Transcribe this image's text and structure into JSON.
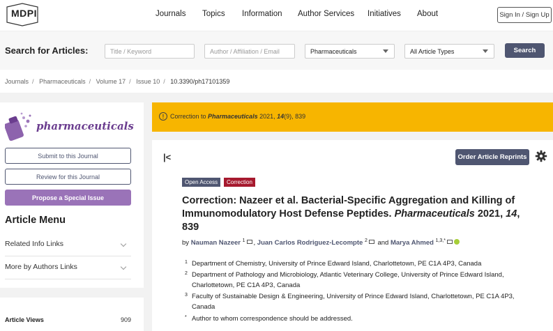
{
  "header": {
    "logo_text": "MDPI",
    "nav": [
      "Journals",
      "Topics",
      "Information",
      "Author Services",
      "Initiatives",
      "About"
    ],
    "sign_in": "Sign In / Sign Up"
  },
  "search": {
    "label": "Search for Articles:",
    "title_placeholder": "Title / Keyword",
    "author_placeholder": "Author / Affiliation / Email",
    "journal_value": "Pharmaceuticals",
    "type_value": "All Article Types",
    "button": "Search"
  },
  "breadcrumb": [
    "Journals",
    "Pharmaceuticals",
    "Volume 17",
    "Issue 10",
    "10.3390/ph17101359"
  ],
  "sidebar": {
    "journal_name": "pharmaceuticals",
    "submit": "Submit to this Journal",
    "review": "Review for this Journal",
    "propose": "Propose a Special Issue",
    "menu_title": "Article Menu",
    "related": "Related Info Links",
    "more_authors": "More by Authors Links",
    "views_label": "Article Views",
    "views_count": "909"
  },
  "alert": {
    "prefix": "Correction to ",
    "journal": "Pharmaceuticals",
    "year": " 2021, ",
    "volume": "14",
    "rest": "(9), 839"
  },
  "article": {
    "reprints": "Order Article Reprints",
    "badge_open": "Open Access",
    "badge_correction": "Correction",
    "title_main": "Correction: Nazeer et al. Bacterial-Specific Aggregation and Killing of Immunomodulatory Host Defense Peptides. ",
    "title_journal": "Pharmaceuticals",
    "title_year": " 2021, ",
    "title_vol": "14",
    "title_page": ", 839",
    "by": "by ",
    "author1": "Nauman Nazeer",
    "author1_sup": "1",
    "author2": "Juan Carlos Rodriguez-Lecompte",
    "author2_sup": "2",
    "and": " and ",
    "author3": "Marya Ahmed",
    "author3_sup": "1,3,*",
    "affiliations": [
      {
        "num": "1",
        "text": "Department of Chemistry, University of Prince Edward Island, Charlottetown, PE C1A 4P3, Canada"
      },
      {
        "num": "2",
        "text": "Department of Pathology and Microbiology, Atlantic Veterinary College, University of Prince Edward Island, Charlottetown, PE C1A 4P3, Canada"
      },
      {
        "num": "3",
        "text": "Faculty of Sustainable Design & Engineering, University of Prince Edward Island, Charlottetown, PE C1A 4P3, Canada"
      },
      {
        "num": "*",
        "text": "Author to whom correspondence should be addressed."
      }
    ]
  },
  "colors": {
    "accent": "#4f5671",
    "alert": "#f7b500",
    "purple": "#9a73b8",
    "correction": "#a6192e"
  }
}
